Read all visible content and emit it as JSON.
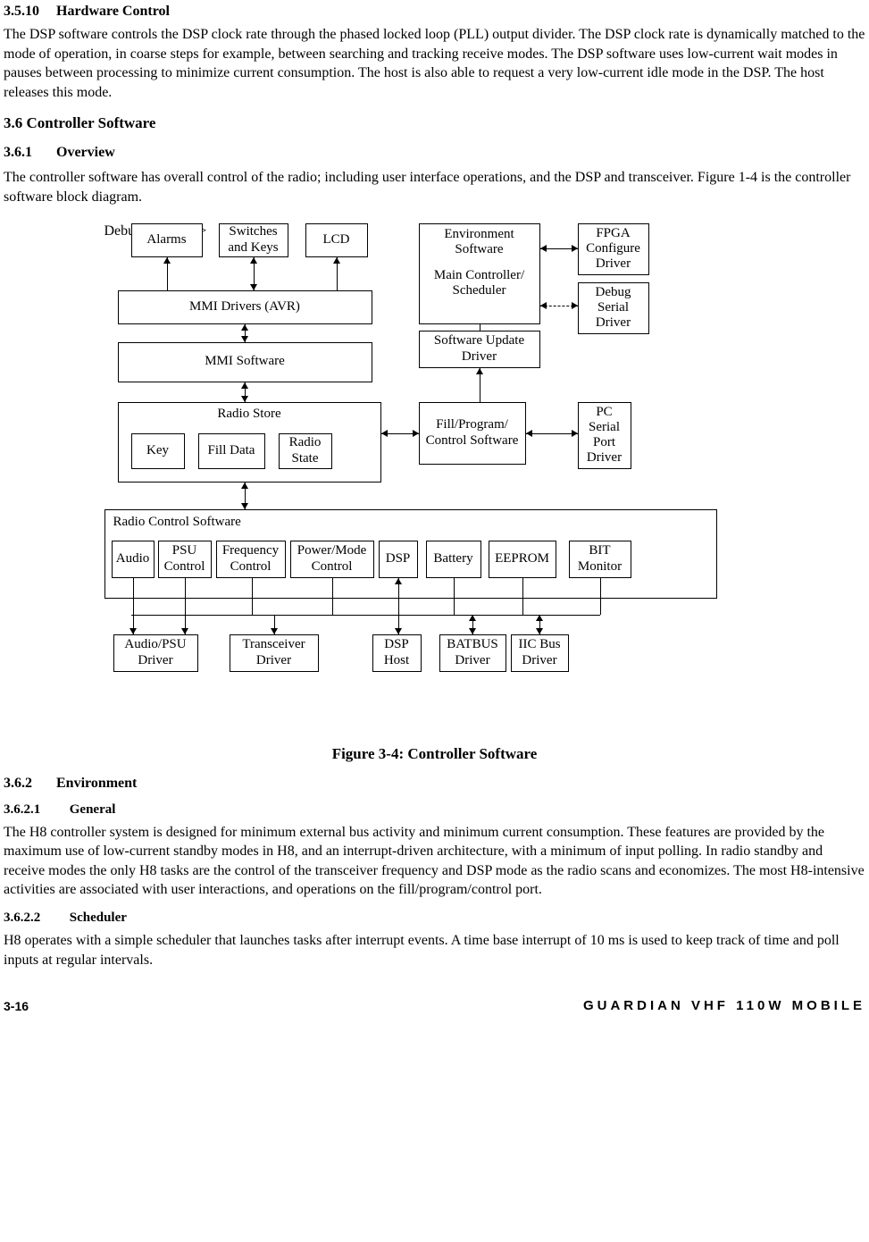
{
  "sections": {
    "s3510": {
      "num": "3.5.10",
      "title": "Hardware Control"
    },
    "s36": {
      "num": "3.6",
      "title": "Controller Software"
    },
    "s361": {
      "num": "3.6.1",
      "title": "Overview"
    },
    "s362": {
      "num": "3.6.2",
      "title": "Environment"
    },
    "s3621": {
      "num": "3.6.2.1",
      "title": "General"
    },
    "s3622": {
      "num": "3.6.2.2",
      "title": "Scheduler"
    }
  },
  "paragraphs": {
    "p_hw": "The DSP software controls the DSP clock rate through the phased locked loop (PLL) output divider.  The DSP clock rate is dynamically matched to the mode of operation, in coarse steps for example, between searching and tracking receive modes.  The DSP software uses low-current wait modes in pauses between processing to minimize current consumption.  The host is also able to request a very low-current idle mode in the DSP.  The host releases this mode.",
    "p_ov": "The controller software has overall control of the radio; including user interface operations, and the DSP and transceiver.  Figure 1-4 is the controller software block diagram.",
    "p_gen": "The H8 controller system is designed for minimum external bus activity and minimum current consumption.  These features are provided by the maximum use of low-current standby modes in H8, and an interrupt-driven architecture, with a minimum of input polling.  In radio standby and receive modes the only H8 tasks are the control of the transceiver frequency and DSP mode as the radio scans and economizes.  The most H8-intensive activities are associated with user interactions, and operations on the fill/program/control port.",
    "p_sch": "H8 operates with a simple scheduler that launches tasks after interrupt events.  A time base interrupt of 10 ms is used to keep track of time and poll inputs at regular intervals."
  },
  "figure_caption": "Figure 3-4:  Controller Software",
  "diagram": {
    "alarms": "Alarms",
    "switches": "Switches and Keys",
    "lcd": "LCD",
    "env_sw": "Environment Software",
    "main_ctrl": "Main Controller/ Scheduler",
    "fpga": "FPGA Configure Driver",
    "debug": "Debug Serial Driver",
    "mmi_drivers": "MMI Drivers (AVR)",
    "mmi_sw": "MMI Software",
    "sw_update": "Software Update Driver",
    "radio_store": "Radio Store",
    "key": "Key",
    "fill_data": "Fill Data",
    "radio_state": "Radio State",
    "fill_prog": "Fill/Program/ Control Software",
    "pc_serial": "PC Serial Port Driver",
    "rcs_label": "Radio Control Software",
    "audio": "Audio",
    "psu": "PSU Control",
    "freq": "Frequency Control",
    "power_mode": "Power/Mode Control",
    "dsp": "DSP",
    "battery": "Battery",
    "eeprom": "EEPROM",
    "bit_mon": "BIT Monitor",
    "audio_psu_drv": "Audio/PSU Driver",
    "trans_drv": "Transceiver Driver",
    "dsp_host": "DSP Host",
    "batbus": "BATBUS Driver",
    "iic": "IIC Bus Driver"
  },
  "footer": {
    "page": "3-16",
    "title": "GUARDIAN VHF 110W MOBILE"
  }
}
